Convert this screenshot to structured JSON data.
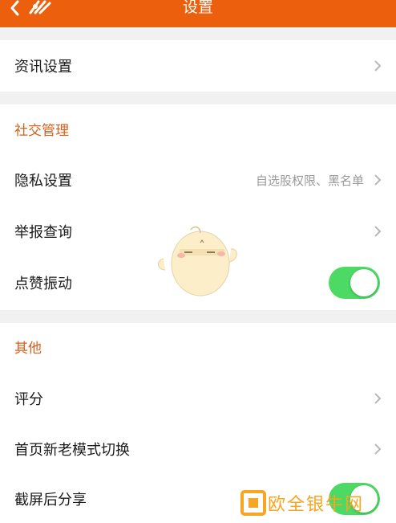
{
  "header": {
    "title": "设置"
  },
  "sections": {
    "news": {
      "label": "资讯设置"
    },
    "social": {
      "title": "社交管理",
      "privacy": {
        "label": "隐私设置",
        "value": "自选股权限、黑名单"
      },
      "report": {
        "label": "举报查询"
      },
      "like_vibrate": {
        "label": "点赞振动",
        "enabled": true
      }
    },
    "other": {
      "title": "其他",
      "rate": {
        "label": "评分"
      },
      "home_mode": {
        "label": "首页新老模式切换"
      },
      "screenshot_share": {
        "label": "截屏后分享",
        "enabled": true
      }
    }
  },
  "watermark": {
    "text": "欧全银牛网"
  },
  "colors": {
    "header": "#ec5f0c",
    "section_title": "#d4611a",
    "toggle_on": "#4cd964"
  }
}
